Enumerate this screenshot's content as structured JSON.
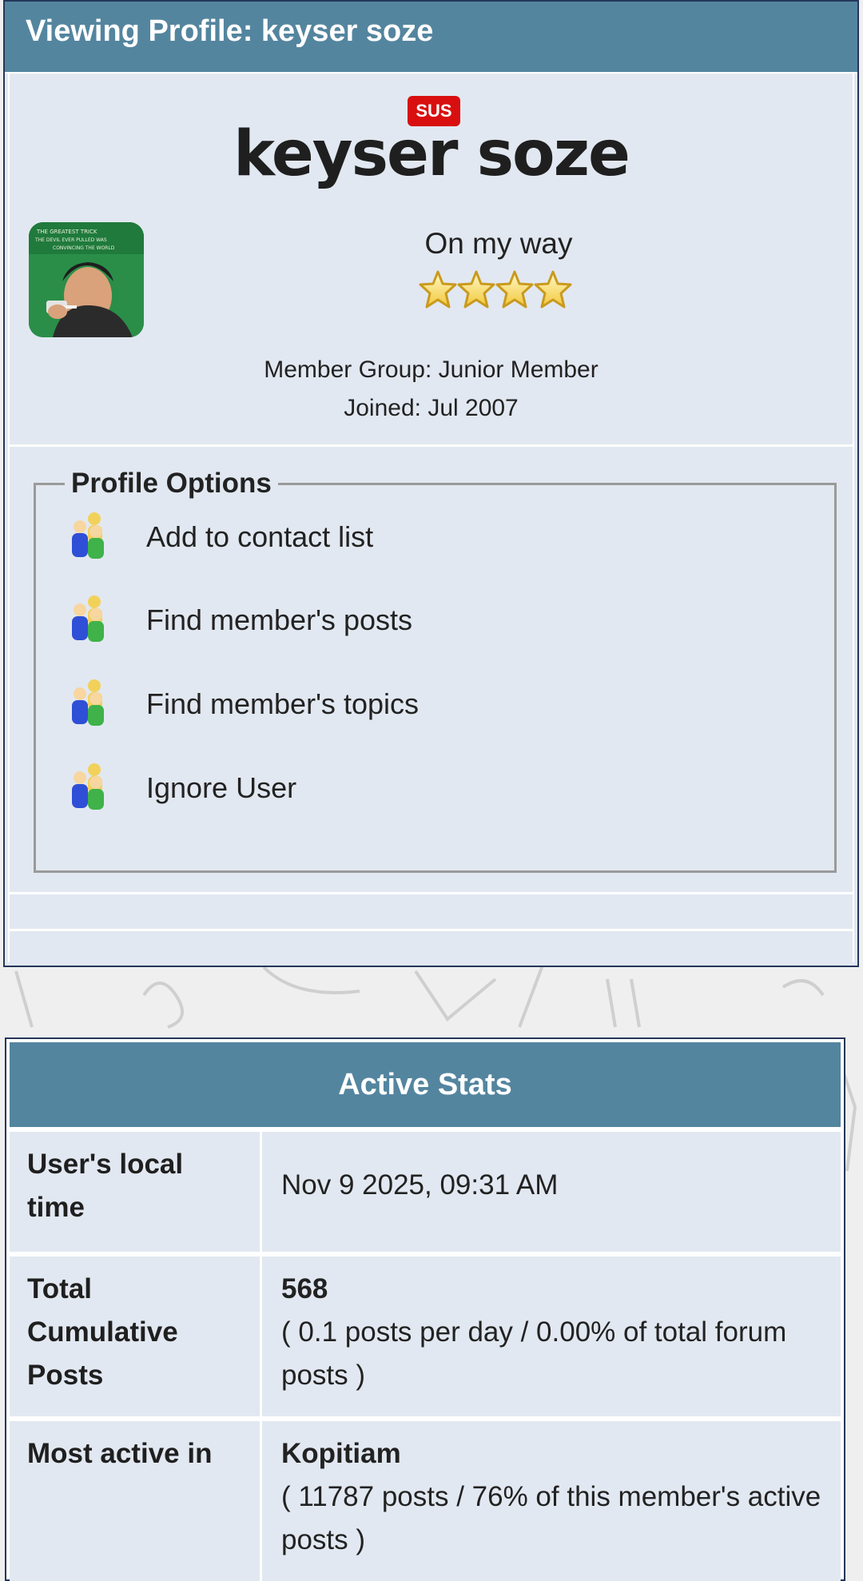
{
  "header": {
    "title": "Viewing Profile: keyser soze"
  },
  "profile": {
    "badge": "SUS",
    "username": "keyser soze",
    "status": "On my way",
    "rating_stars": 4,
    "member_group": "Member Group: Junior Member",
    "joined": "Joined: Jul 2007",
    "avatar_icon": "avatar-image"
  },
  "options": {
    "title": "Profile Options",
    "items": [
      {
        "label": "Add to contact list",
        "icon": "members-icon"
      },
      {
        "label": "Find member's posts",
        "icon": "members-icon"
      },
      {
        "label": "Find member's topics",
        "icon": "members-icon"
      },
      {
        "label": "Ignore User",
        "icon": "members-icon"
      }
    ]
  },
  "stats": {
    "title": "Active Stats",
    "rows": [
      {
        "label": "User's local time",
        "value": "Nov 9 2025, 09:31 AM"
      },
      {
        "label": "Total Cumulative Posts",
        "value_bold": "568",
        "value": "( 0.1 posts per day / 0.00% of total forum posts )"
      },
      {
        "label": "Most active in",
        "value_bold": "Kopitiam",
        "value": "( 11787 posts / 76% of this member's active posts )"
      }
    ]
  },
  "colors": {
    "header_bg": "#54859f",
    "card_bg": "#e2e8f1",
    "badge_red": "#d90f0f",
    "border_navy": "#24365a"
  }
}
